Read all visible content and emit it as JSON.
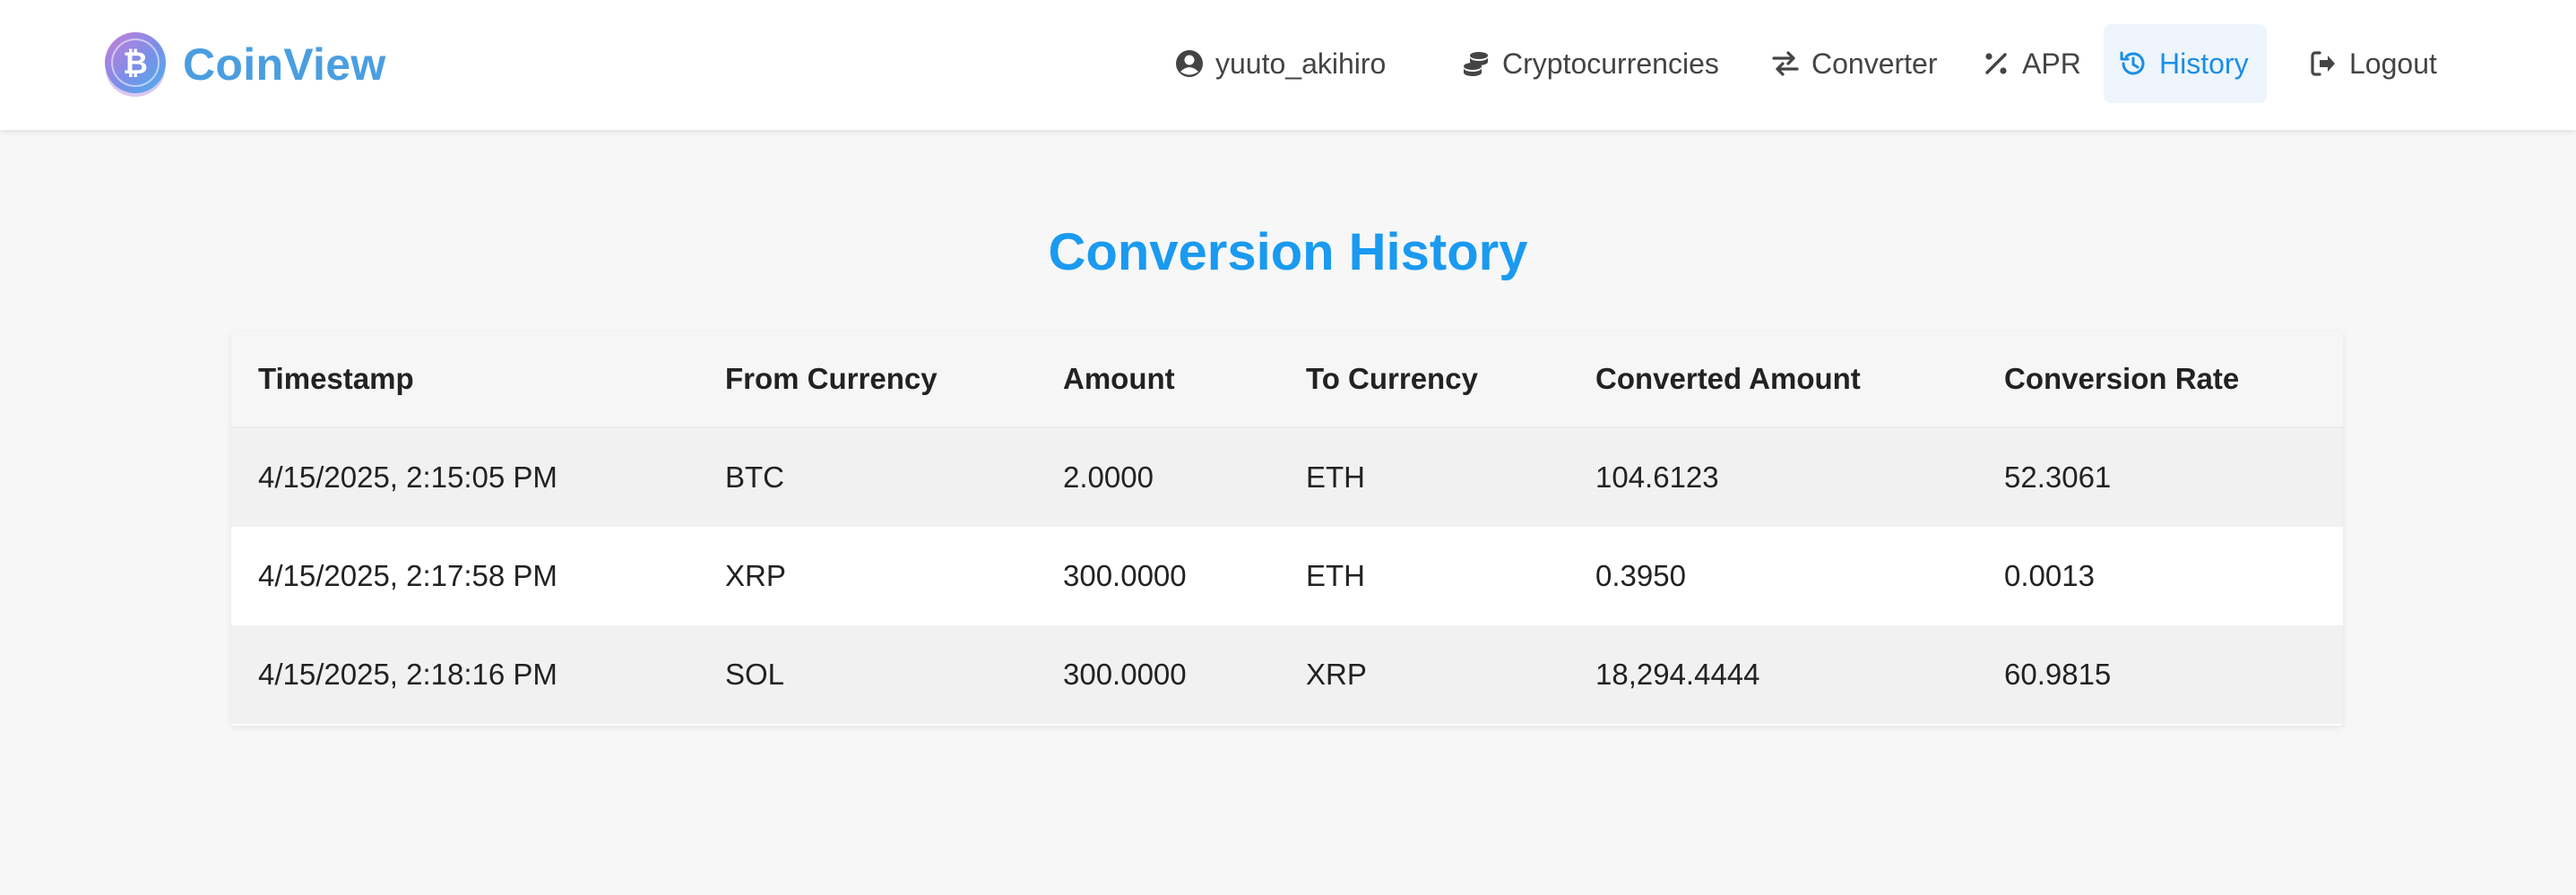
{
  "app": {
    "name": "CoinView",
    "accent_color": "#4a9ee0"
  },
  "nav": {
    "user": {
      "label": "yuuto_akihiro",
      "icon": "user-circle-icon"
    },
    "items": [
      {
        "label": "Cryptocurrencies",
        "icon": "coins-icon"
      },
      {
        "label": "Converter",
        "icon": "swap-arrows-icon"
      },
      {
        "label": "APR",
        "icon": "percent-icon"
      },
      {
        "label": "History",
        "icon": "history-icon",
        "active": true
      },
      {
        "label": "Logout",
        "icon": "logout-icon"
      }
    ],
    "active_color": "#1a8ee6"
  },
  "page": {
    "title": "Conversion History",
    "title_color": "#1a9af0"
  },
  "table": {
    "columns": [
      "Timestamp",
      "From Currency",
      "Amount",
      "To Currency",
      "Converted Amount",
      "Conversion Rate"
    ],
    "rows": [
      [
        "4/15/2025, 2:15:05 PM",
        "BTC",
        "2.0000",
        "ETH",
        "104.6123",
        "52.3061"
      ],
      [
        "4/15/2025, 2:17:58 PM",
        "XRP",
        "300.0000",
        "ETH",
        "0.3950",
        "0.0013"
      ],
      [
        "4/15/2025, 2:18:16 PM",
        "SOL",
        "300.0000",
        "XRP",
        "18,294.4444",
        "60.9815"
      ]
    ]
  }
}
